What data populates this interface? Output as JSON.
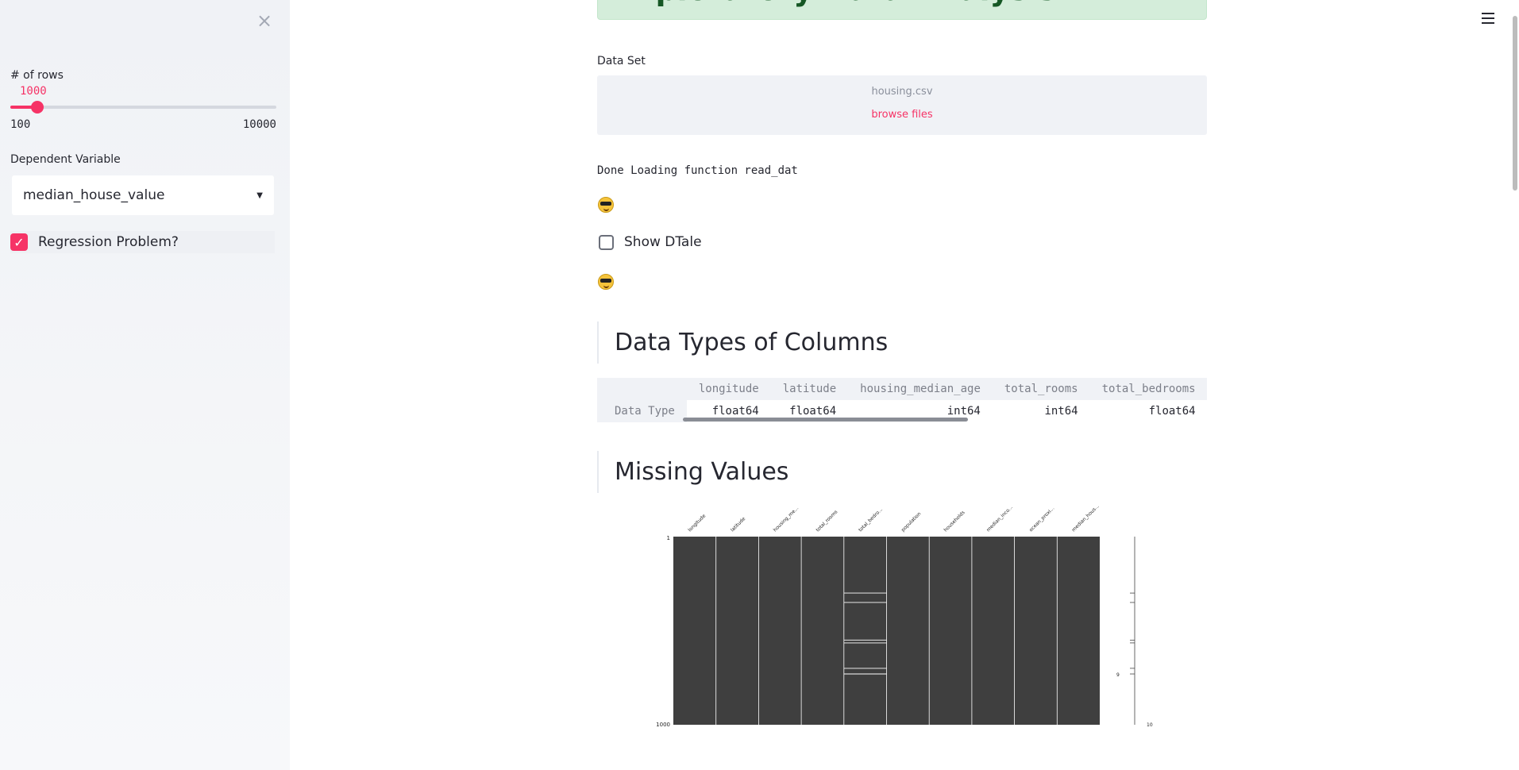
{
  "sidebar": {
    "close_label": "×",
    "rows": {
      "label": "# of rows",
      "value": "1000",
      "min_label": "100",
      "max_label": "10000",
      "fraction": 0.1
    },
    "dependent": {
      "label": "Dependent Variable",
      "selected": "median_house_value"
    },
    "regression": {
      "label": "Regression Problem?",
      "checked": true
    }
  },
  "main": {
    "banner_title": "Exploratory Data Analysis",
    "dataset_label": "Data Set",
    "uploader": {
      "filename": "housing.csv",
      "browse": "browse files"
    },
    "status_text": "Done Loading function read_dat",
    "emoji": "sunglasses-face",
    "show_dtale": {
      "label": "Show DTale",
      "checked": false
    },
    "types_heading": "Data Types of Columns",
    "types_table": {
      "row_label": "Data Type",
      "columns": [
        "longitude",
        "latitude",
        "housing_median_age",
        "total_rooms",
        "total_bedrooms"
      ],
      "values": [
        "float64",
        "float64",
        "int64",
        "int64",
        "float64"
      ]
    },
    "missing_heading": "Missing Values",
    "missing_chart": {
      "columns": [
        "longitude",
        "latitude",
        "housing_me...",
        "total_rooms",
        "total_bedro...",
        "population",
        "households",
        "median_inco...",
        "ocean_proxi...",
        "median_hous..."
      ],
      "y_top": "1",
      "y_bottom": "1000",
      "spark_mid": "9",
      "spark_right": "10",
      "missing_rows_in_total_bedrooms": [
        300,
        350,
        550,
        565,
        700,
        730
      ]
    }
  },
  "colors": {
    "accent": "#f63366",
    "banner_bg": "#d4edda",
    "banner_text": "#155724",
    "matrix": "#3f3f3f"
  }
}
